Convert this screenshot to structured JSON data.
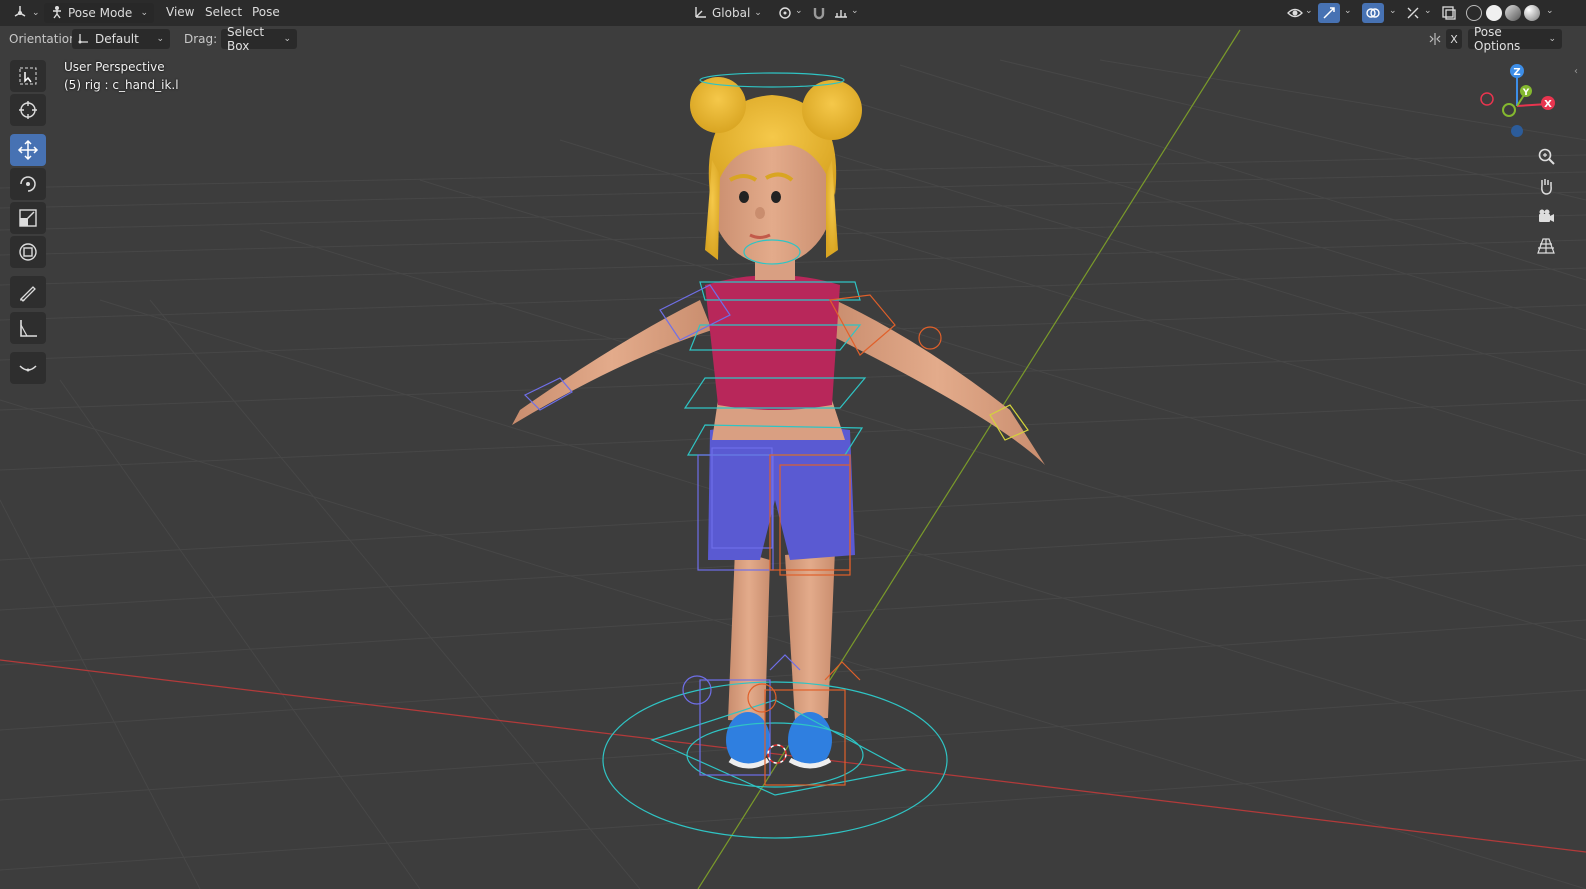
{
  "header": {
    "mode_label": "Pose Mode",
    "menus": [
      "View",
      "Select",
      "Pose"
    ],
    "transform_orientation": "Global"
  },
  "subheader": {
    "orientation_label": "Orientation:",
    "orientation_value": "Default",
    "drag_label": "Drag:",
    "drag_value": "Select Box",
    "pose_options_label": "Pose Options",
    "x_label": "X"
  },
  "viewport": {
    "perspective_label": "User Perspective",
    "active_object_label": "(5) rig : c_hand_ik.l"
  },
  "gizmo": {
    "axes": [
      "Z",
      "Y",
      "X"
    ],
    "colors": {
      "x": "#e8354f",
      "y": "#84b82f",
      "z": "#3d8ee8"
    }
  },
  "toolbar": {
    "tools": [
      "select-box-tool",
      "cursor-tool",
      "move-tool",
      "rotate-tool",
      "scale-tool",
      "transform-tool",
      "annotate-tool",
      "measure-tool",
      "relax-pose-tool"
    ],
    "active_tool": "move-tool"
  },
  "colors": {
    "accent": "#4772b3",
    "viewport_bg": "#3d3d3d",
    "header_bg": "#2b2b2b",
    "bone_cyan": "#2fc4c4",
    "bone_blue": "#6f6fe8",
    "bone_orange": "#e0602a"
  }
}
